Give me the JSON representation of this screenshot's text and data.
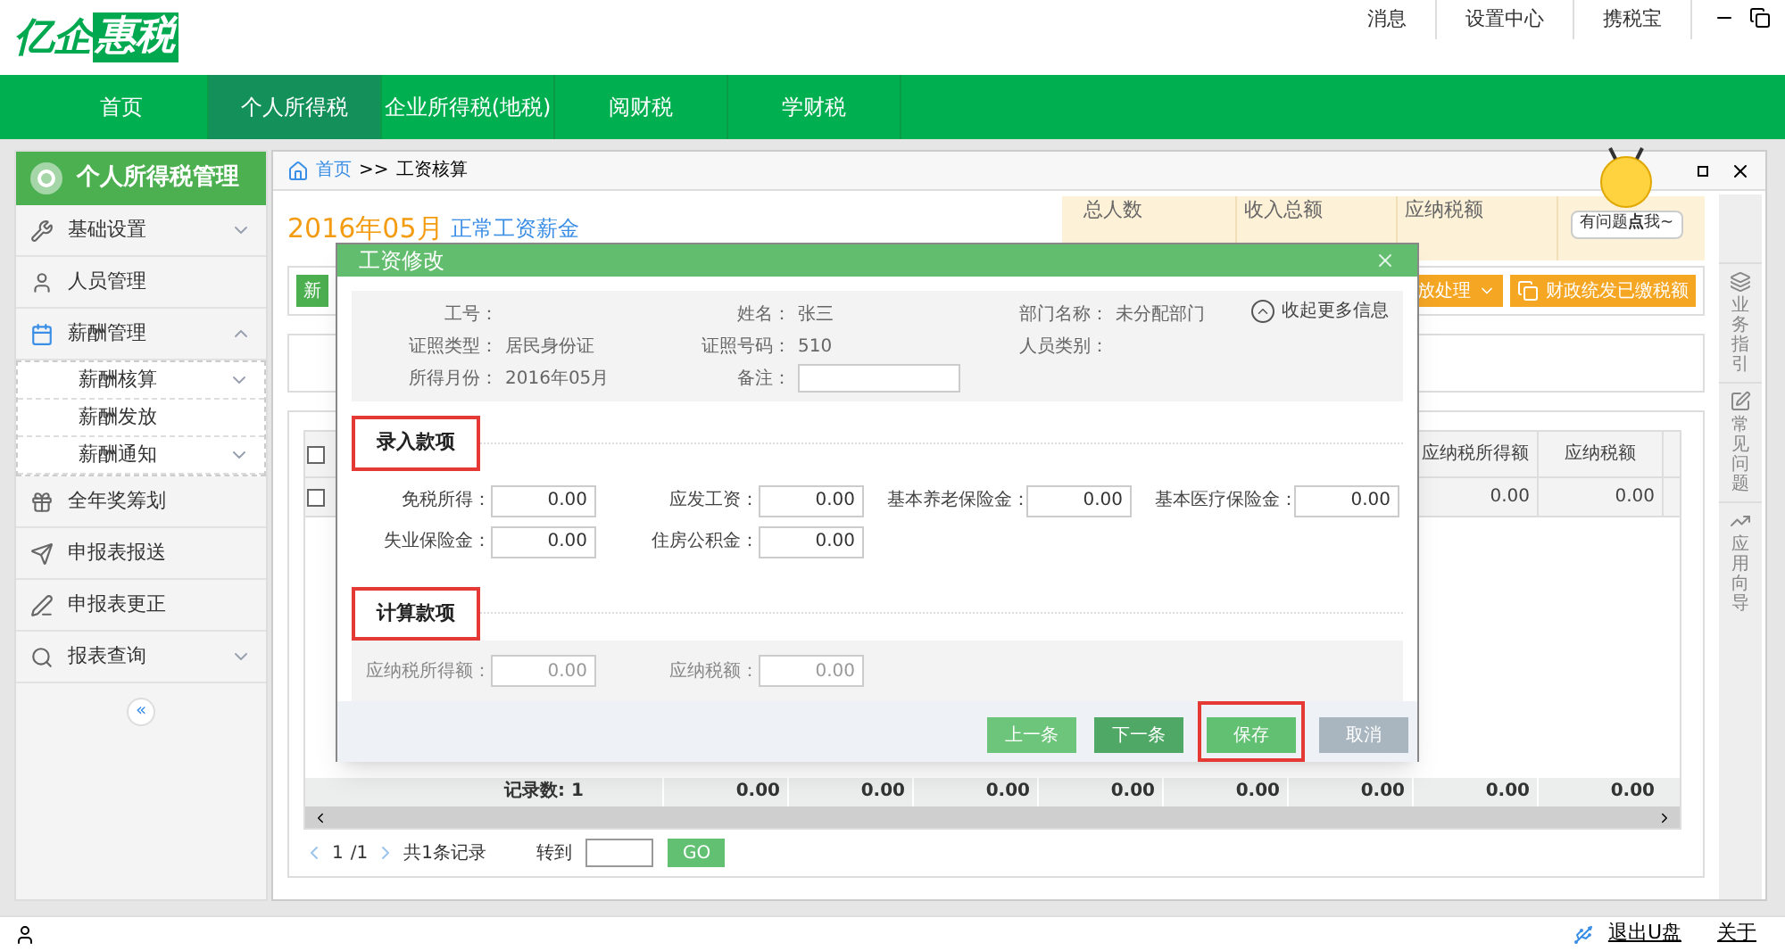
{
  "logo": {
    "lead": "亿企",
    "boxed": "惠税"
  },
  "header_links": [
    "消息",
    "设置中心",
    "携税宝"
  ],
  "nav": [
    {
      "label": "首页",
      "selected": false
    },
    {
      "label": "个人所得税",
      "selected": true
    },
    {
      "label": "企业所得税(地税)",
      "selected": false
    },
    {
      "label": "阅财税",
      "selected": false
    },
    {
      "label": "学财税",
      "selected": false
    }
  ],
  "sidebar": {
    "title": "个人所得税管理",
    "items": [
      {
        "label": "基础设置",
        "expanded": false
      },
      {
        "label": "人员管理"
      },
      {
        "label": "薪酬管理",
        "expanded": true,
        "children": [
          {
            "label": "薪酬核算",
            "expanded": false
          },
          {
            "label": "薪酬发放"
          },
          {
            "label": "薪酬通知",
            "expanded": false
          }
        ]
      },
      {
        "label": "全年奖筹划"
      },
      {
        "label": "申报表报送"
      },
      {
        "label": "申报表更正"
      },
      {
        "label": "报表查询",
        "expanded": false
      }
    ],
    "collapse": "«"
  },
  "breadcrumb": {
    "home": "首页",
    "sep": ">>",
    "current": "工资核算"
  },
  "period": {
    "month": "2016年05月",
    "type": "正常工资薪金"
  },
  "summary": [
    {
      "label": "总人数"
    },
    {
      "label": "收入总额"
    },
    {
      "label": "应纳税额"
    }
  ],
  "mascot": {
    "bubble": "有问题**点**我~"
  },
  "toolbar": {
    "new": "新",
    "distribute": "放处理",
    "fiscal": "财政统发已缴税额"
  },
  "table": {
    "all_checked": false,
    "columns": [
      "应纳税所得额",
      "应纳税额"
    ],
    "rows": [
      {
        "checked": false,
        "cells": [
          "0.00",
          "0.00"
        ]
      }
    ],
    "footer": {
      "count": "记录数: 1",
      "totals": [
        "0.00",
        "0.00",
        "0.00",
        "0.00",
        "0.00",
        "0.00",
        "0.00",
        "0.00"
      ]
    }
  },
  "pager": {
    "page": "1",
    "total": "/1",
    "records": "共1条记录",
    "goto": "转到",
    "go": "GO"
  },
  "rail": [
    "业务指引",
    "常见问题",
    "应用向导"
  ],
  "dialog": {
    "title": "工资修改",
    "toggle": "收起更多信息",
    "info": [
      [
        {
          "label": "工号："
        },
        {
          "label": "姓名：",
          "value": "张三"
        },
        {
          "label": "部门名称：",
          "value": "未分配部门"
        }
      ],
      [
        {
          "label": "证照类型：",
          "value": "居民身份证"
        },
        {
          "label": "证照号码：",
          "value": "510"
        },
        {
          "label": "人员类别："
        }
      ],
      [
        {
          "label": "所得月份：",
          "value": "2016年05月"
        },
        {
          "label": "备注：",
          "kind": "input"
        }
      ]
    ],
    "sections": [
      {
        "title": "录入款项",
        "highlighted": true,
        "editable": true,
        "fields": [
          {
            "label": "免税所得：",
            "value": "0.00"
          },
          {
            "label": "应发工资：",
            "value": "0.00"
          },
          {
            "label": "基本养老保险金：",
            "value": "0.00"
          },
          {
            "label": "基本医疗保险金：",
            "value": "0.00"
          },
          {
            "label": "失业保险金：",
            "value": "0.00"
          },
          {
            "label": "住房公积金：",
            "value": "0.00"
          }
        ]
      },
      {
        "title": "计算款项",
        "highlighted": true,
        "editable": false,
        "fields": [
          {
            "label": "应纳税所得额：",
            "value": "0.00"
          },
          {
            "label": "应纳税额：",
            "value": "0.00"
          }
        ]
      }
    ],
    "buttons": [
      {
        "label": "上一条",
        "kind": "prev",
        "highlighted": false
      },
      {
        "label": "下一条",
        "kind": "next",
        "highlighted": false
      },
      {
        "label": "保存",
        "kind": "save",
        "highlighted": true
      },
      {
        "label": "取消",
        "kind": "cancel",
        "highlighted": false
      }
    ]
  },
  "status_bar": {
    "eject": "退出U盘",
    "about": "关于"
  }
}
